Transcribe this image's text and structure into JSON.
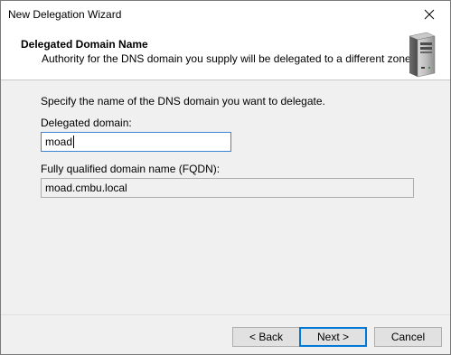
{
  "window": {
    "title": "New Delegation Wizard"
  },
  "header": {
    "title": "Delegated Domain Name",
    "subtitle": "Authority for the DNS domain you supply will be delegated to a different zone.",
    "icon": "server-icon"
  },
  "form": {
    "prompt": "Specify the name of the DNS domain you want to delegate.",
    "delegated_label": "Delegated domain:",
    "delegated_value": "moad",
    "fqdn_label": "Fully qualified domain name (FQDN):",
    "fqdn_value": "moad.cmbu.local"
  },
  "buttons": {
    "back": "< Back",
    "next": "Next >",
    "cancel": "Cancel"
  },
  "colors": {
    "accent": "#0078d7",
    "focus_border": "#3a86d4"
  }
}
